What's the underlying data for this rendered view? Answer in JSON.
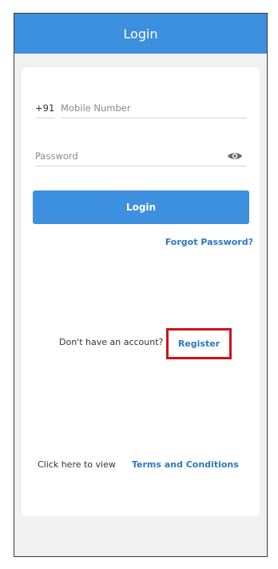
{
  "header": {
    "title": "Login"
  },
  "form": {
    "country_code": "+91",
    "mobile_placeholder": "Mobile Number",
    "password_placeholder": "Password",
    "login_label": "Login",
    "forgot_label": "Forgot Password?"
  },
  "register": {
    "prompt": "Don't have an account?",
    "link": "Register"
  },
  "terms": {
    "prefix": "Click here to view",
    "link": "Terms and Conditions"
  },
  "colors": {
    "header": "#3d8fe0",
    "button": "#3d8fe0",
    "link": "#2b78c2",
    "highlight_box": "#d0111b"
  },
  "icons": {
    "password_toggle": "eye-icon"
  }
}
